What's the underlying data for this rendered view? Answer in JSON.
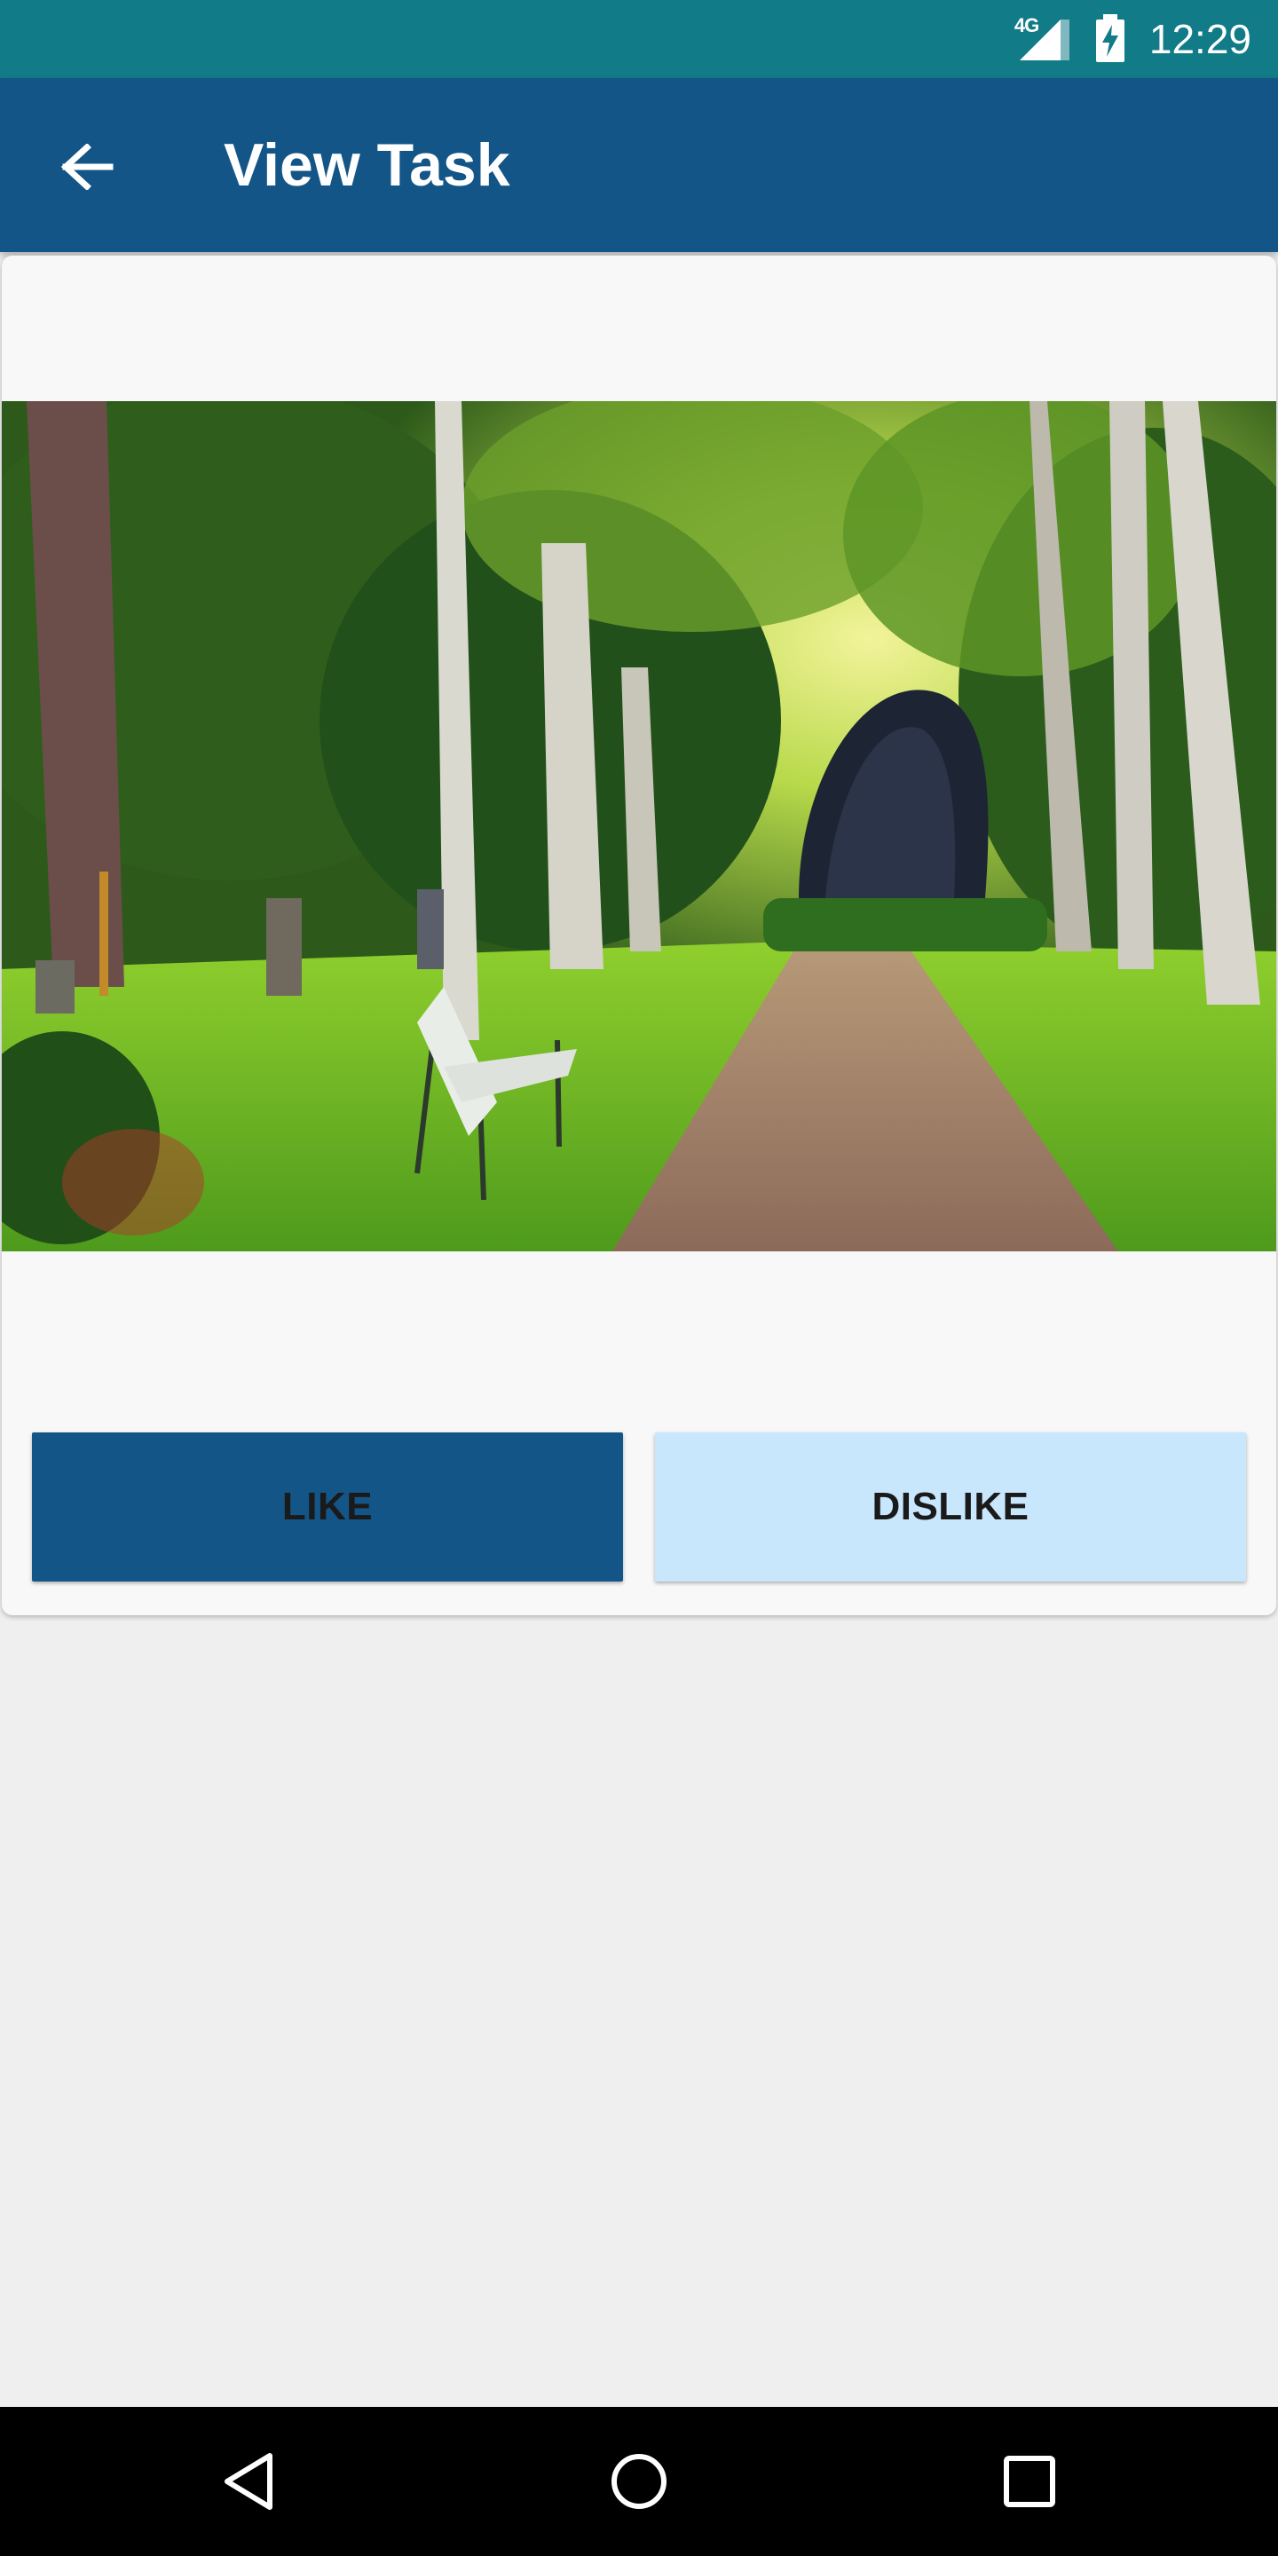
{
  "status_bar": {
    "network_label": "4G",
    "time": "12:29",
    "icons": [
      "signal-icon",
      "battery-charging-icon"
    ]
  },
  "app_bar": {
    "title": "View Task",
    "back_icon": "arrow-left-icon"
  },
  "task": {
    "image": "park-path-with-bench-photo"
  },
  "actions": {
    "like_label": "LIKE",
    "dislike_label": "DISLIKE"
  },
  "nav_bar": {
    "icons": [
      "back-triangle-icon",
      "home-circle-icon",
      "recents-square-icon"
    ]
  },
  "colors": {
    "status_bar": "#127b88",
    "app_bar": "#135587",
    "like_button": "#135587",
    "dislike_button": "#c8e6fc",
    "background": "#efefef",
    "card": "#f8f8f8"
  }
}
